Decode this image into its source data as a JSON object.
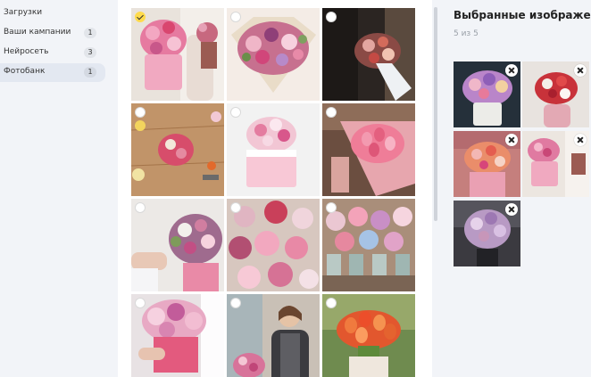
{
  "sidebar": {
    "items": [
      {
        "label": "Загрузки",
        "count": ""
      },
      {
        "label": "Ваши кампании",
        "count": "1"
      },
      {
        "label": "Нейросеть",
        "count": "3"
      },
      {
        "label": "Фотобанк",
        "count": "1"
      }
    ],
    "active_item": "Фотобанк"
  },
  "gallery": {
    "tiles": [
      {
        "subject": "woman holding pink box bouquet",
        "selected": true
      },
      {
        "subject": "large mixed bouquet in wrapping",
        "selected": false
      },
      {
        "subject": "man holding bouquet at dark door",
        "selected": false
      },
      {
        "subject": "florist making bouquet on wooden table",
        "selected": false
      },
      {
        "subject": "bouquet in white box",
        "selected": false
      },
      {
        "subject": "pink tulips bouquet",
        "selected": false
      },
      {
        "subject": "florist arranging flowers in box",
        "selected": false
      },
      {
        "subject": "peonies and roses display",
        "selected": false
      },
      {
        "subject": "flower shop buckets",
        "selected": false
      },
      {
        "subject": "hydrangea box bouquet",
        "selected": false
      },
      {
        "subject": "smiling florist in shop",
        "selected": false
      },
      {
        "subject": "orange tulips bouquet",
        "selected": false
      }
    ]
  },
  "panel": {
    "title": "Выбранные изображения",
    "count_text": "5 из 5",
    "selected_images": [
      {
        "subject": "bouquet in box on dark background"
      },
      {
        "subject": "woman with red and white bouquet"
      },
      {
        "subject": "woman with pink box bouquet"
      },
      {
        "subject": "woman holding bouquet in box"
      },
      {
        "subject": "person holding lilac bouquet"
      }
    ]
  },
  "colors": {
    "accent_check": "#ffdb4d",
    "sidebar_bg": "#f2f4f8",
    "active_item_bg": "#e3e8f1"
  }
}
